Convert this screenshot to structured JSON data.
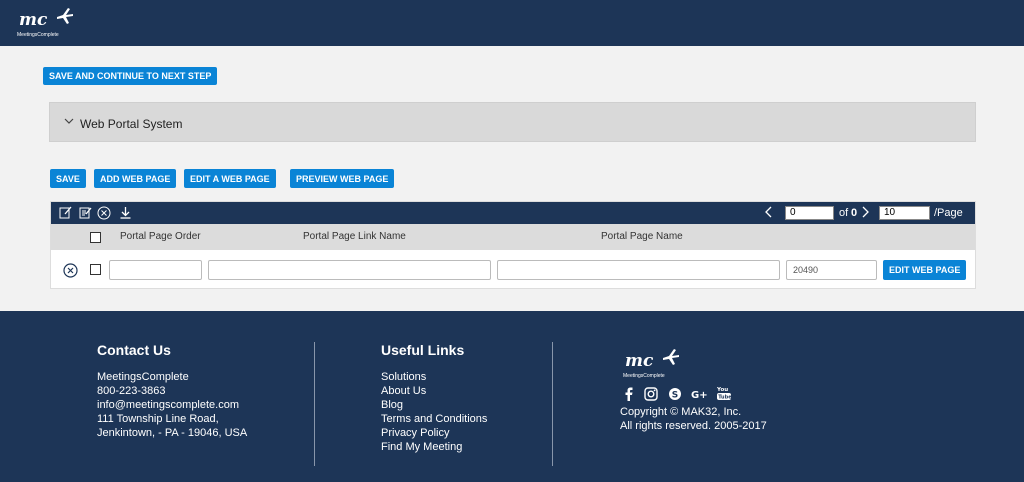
{
  "header": {
    "logo_text": "mc",
    "brand_name": "MeetingsComplete"
  },
  "toolbar": {
    "save_continue_label": "SAVE AND CONTINUE TO NEXT STEP"
  },
  "section": {
    "title": "Web Portal System"
  },
  "actions": {
    "save_label": "SAVE",
    "add_label": "ADD WEB PAGE",
    "edit_label": "EDIT A WEB PAGE",
    "preview_label": "PREVIEW WEB PAGE"
  },
  "grid": {
    "pager": {
      "page_value": "0",
      "of_text": "of",
      "total": "0",
      "page_size": "10",
      "per_page_label": "/Page"
    },
    "columns": [
      "Portal Page Order",
      "Portal Page Link Name",
      "Portal Page Name"
    ],
    "row": {
      "order": "",
      "link_name": "",
      "page_name": "",
      "id_value": "20490",
      "edit_label": "EDIT WEB PAGE"
    }
  },
  "footer": {
    "contact": {
      "title": "Contact Us",
      "lines": [
        "MeetingsComplete",
        "800-223-3863",
        "info@meetingscomplete.com",
        "111 Township Line Road,",
        "Jenkintown, - PA - 19046, USA"
      ]
    },
    "links": {
      "title": "Useful Links",
      "items": [
        "Solutions",
        "About Us",
        "Blog",
        "Terms and Conditions",
        "Privacy Policy",
        "Find My Meeting"
      ]
    },
    "brand": {
      "logo_text": "mc",
      "brand_name": "MeetingsComplete",
      "copyright": "Copyright © MAK32, Inc.",
      "rights": "All rights reserved. 2005-2017"
    }
  }
}
